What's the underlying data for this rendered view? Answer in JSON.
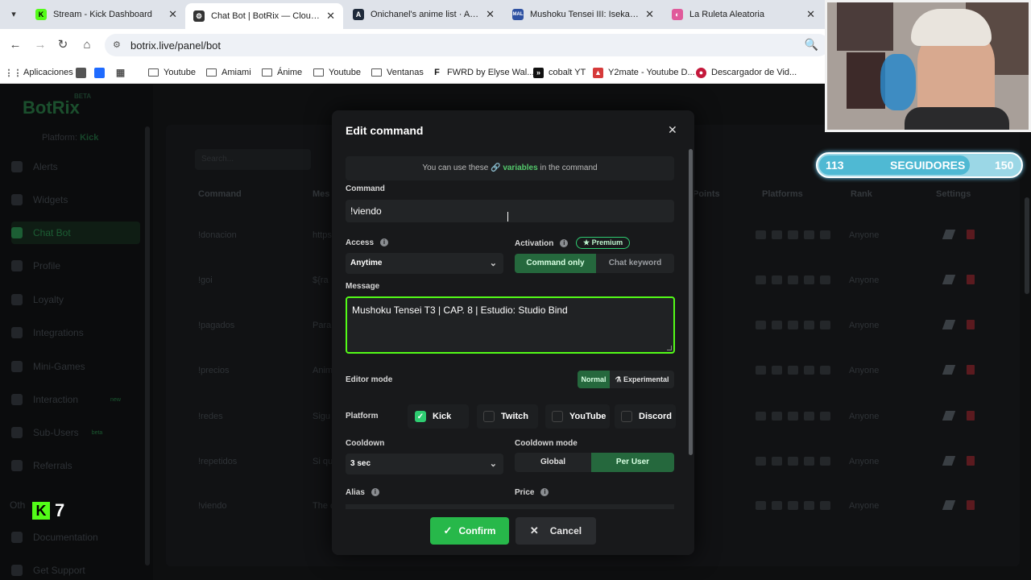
{
  "browser": {
    "tabs": [
      {
        "title": "Stream - Kick Dashboard",
        "fav": "K",
        "color": "#53fc18"
      },
      {
        "title": "Chat Bot | BotRix — Cloud Stre",
        "fav": "⚙",
        "color": "#333333"
      },
      {
        "title": "Onichanel's anime list · AniList",
        "fav": "A",
        "color": "#1f2a3a"
      },
      {
        "title": "Mushoku Tensei III: Isekai Ittara",
        "fav": "MAL",
        "color": "#2e51a2"
      },
      {
        "title": "La Ruleta Aleatoria",
        "fav": "◐",
        "color": "#e05a9b"
      }
    ],
    "url": "botrix.live/panel/bot",
    "bookmarks": {
      "apps": "Aplicaciones",
      "items": [
        "Youtube",
        "Amiami",
        "Ánime",
        "Youtube",
        "Ventanas"
      ],
      "fwrd": "FWRD by Elyse Wal...",
      "cobalt": "cobalt YT",
      "y2mate": "Y2mate - Youtube D...",
      "descargador": "Descargador de Vid..."
    }
  },
  "background": {
    "logo": "BotRix",
    "logo_badge": "BETA",
    "platform_label": "Platform:",
    "platform_value": "Kick",
    "sidebar_items": [
      "Alerts",
      "Widgets",
      "Chat Bot",
      "Profile",
      "Loyalty",
      "Integrations",
      "Mini-Games",
      "Interaction",
      "Sub-Users",
      "Referrals",
      "Documentation",
      "Get Support"
    ],
    "sidebar_badges": {
      "interaction": "new",
      "subusers": "beta"
    },
    "other_label": "Oth",
    "search_placeholder": "Search...",
    "columns": [
      "Command",
      "Mes",
      "Points",
      "Platforms",
      "Rank",
      "Settings"
    ],
    "rows": [
      {
        "cmd": "!donacion",
        "msg": "https",
        "rank": "Anyone"
      },
      {
        "cmd": "!goi",
        "msg": "${ra",
        "rank": "Anyone"
      },
      {
        "cmd": "!pagados",
        "msg": "Para",
        "rank": "Anyone"
      },
      {
        "cmd": "!precios",
        "msg": "Anim",
        "rank": "Anyone"
      },
      {
        "cmd": "!redes",
        "msg": "Sigu",
        "rank": "Anyone"
      },
      {
        "cmd": "!repetidos",
        "msg": "Si qu",
        "rank": "Anyone"
      },
      {
        "cmd": "!viendo",
        "msg": "The c",
        "rank": "Anyone"
      }
    ]
  },
  "overlay": {
    "followers_current": "113",
    "followers_label": "SEGUIDORES",
    "followers_goal": "150",
    "followers_progress": 0.753,
    "kick_number": "7"
  },
  "modal": {
    "title": "Edit command",
    "variables_pre": "You can use these",
    "variables_link": "variables",
    "variables_post": "in the command",
    "command_label": "Command",
    "command_value": "!viendo",
    "access_label": "Access",
    "access_value": "Anytime",
    "activation_label": "Activation",
    "premium_label": "Premium",
    "activation_options": [
      "Command only",
      "Chat keyword"
    ],
    "message_label": "Message",
    "message_value": "Mushoku Tensei T3 | CAP. 8 | Estudio: Studio Bind",
    "editor_mode_label": "Editor mode",
    "editor_modes": [
      "Normal",
      "Experimental"
    ],
    "platform_label": "Platform",
    "platforms": [
      {
        "name": "Kick",
        "checked": true
      },
      {
        "name": "Twitch",
        "checked": false
      },
      {
        "name": "YouTube",
        "checked": false
      },
      {
        "name": "Discord",
        "checked": false
      }
    ],
    "cooldown_label": "Cooldown",
    "cooldown_value": "3 sec",
    "cooldown_mode_label": "Cooldown mode",
    "cooldown_modes": [
      "Global",
      "Per User"
    ],
    "alias_label": "Alias",
    "price_label": "Price",
    "confirm_label": "Confirm",
    "cancel_label": "Cancel"
  },
  "colors": {
    "accent": "#53fc18",
    "confirm": "#27b84a",
    "active_segment": "#25683d"
  }
}
